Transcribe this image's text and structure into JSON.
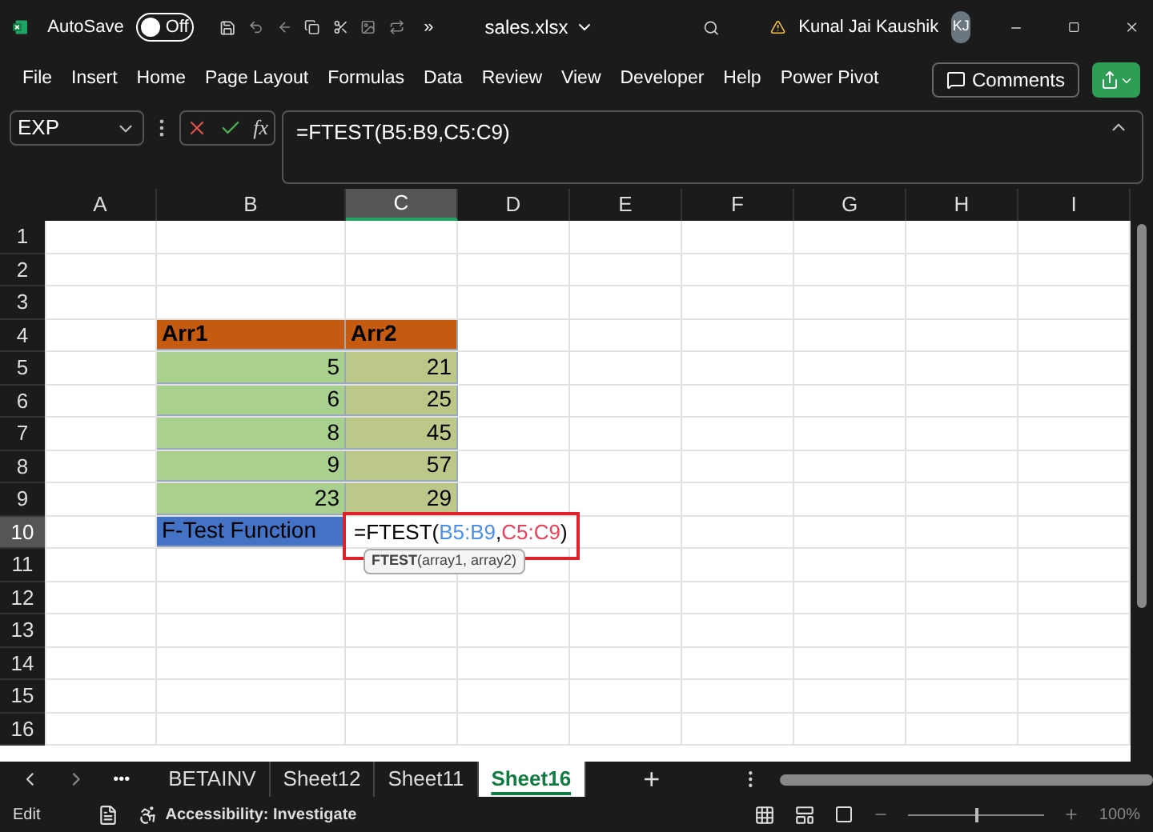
{
  "title_bar": {
    "autosave_label": "AutoSave",
    "autosave": {
      "on": false,
      "label": "Off"
    },
    "more": "»",
    "file_name": "sales.xlsx",
    "user": "Kunal Jai Kaushik",
    "initials": "KJ"
  },
  "menu": [
    "File",
    "Insert",
    "Home",
    "Page Layout",
    "Formulas",
    "Data",
    "Review",
    "View",
    "Developer",
    "Help",
    "Power Pivot"
  ],
  "comments_button": "Comments",
  "formula_bar": {
    "name_box": "EXP",
    "fx": "fx",
    "formula": "=FTEST(B5:B9,C5:C9)"
  },
  "columns": [
    {
      "label": "A",
      "selected": false
    },
    {
      "label": "B",
      "selected": false
    },
    {
      "label": "C",
      "selected": true
    },
    {
      "label": "D",
      "selected": false
    },
    {
      "label": "E",
      "selected": false
    },
    {
      "label": "F",
      "selected": false
    },
    {
      "label": "G",
      "selected": false
    },
    {
      "label": "H",
      "selected": false
    },
    {
      "label": "I",
      "selected": false
    }
  ],
  "rows": [
    {
      "label": "1",
      "selected": false
    },
    {
      "label": "2",
      "selected": false
    },
    {
      "label": "3",
      "selected": false
    },
    {
      "label": "4",
      "selected": false,
      "column_b": {
        "kind": "header",
        "text": "Arr1"
      },
      "column_c": {
        "kind": "header",
        "text": "Arr2"
      }
    },
    {
      "label": "5",
      "selected": false,
      "column_b": {
        "kind": "green",
        "text": "5"
      },
      "column_c": {
        "kind": "olive",
        "text": "21"
      }
    },
    {
      "label": "6",
      "selected": false,
      "column_b": {
        "kind": "green",
        "text": "6"
      },
      "column_c": {
        "kind": "olive",
        "text": "25"
      }
    },
    {
      "label": "7",
      "selected": false,
      "column_b": {
        "kind": "green",
        "text": "8"
      },
      "column_c": {
        "kind": "olive",
        "text": "45"
      }
    },
    {
      "label": "8",
      "selected": false,
      "column_b": {
        "kind": "green",
        "text": "9"
      },
      "column_c": {
        "kind": "olive",
        "text": "57"
      }
    },
    {
      "label": "9",
      "selected": false,
      "column_b": {
        "kind": "green",
        "text": "23"
      },
      "column_c": {
        "kind": "olive",
        "text": "29"
      }
    },
    {
      "label": "10",
      "selected": true,
      "column_b": {
        "kind": "blue",
        "text": "F-Test Function"
      },
      "column_c": {
        "kind": "editing",
        "opening": "=FTEST(",
        "arguments": [
          {
            "text": "B5:B9",
            "color": "#4a8fe8"
          },
          {
            "text": "C5:C9",
            "color": "#e8425a"
          }
        ],
        "separator": ",",
        "closing": ")"
      }
    },
    {
      "label": "11",
      "selected": false
    },
    {
      "label": "12",
      "selected": false
    },
    {
      "label": "13",
      "selected": false
    },
    {
      "label": "14",
      "selected": false
    },
    {
      "label": "15",
      "selected": false
    },
    {
      "label": "16",
      "selected": false
    }
  ],
  "tooltip": "**FTEST**(array1, array2)",
  "sheet_tabs": [
    {
      "label": "BETAINV",
      "selected": false
    },
    {
      "label": "Sheet12",
      "selected": false
    },
    {
      "label": "Sheet11",
      "selected": false
    },
    {
      "label": "Sheet16",
      "selected": true
    }
  ],
  "tab_more": "•••",
  "add_sheet": "+",
  "status_bar": {
    "mode": "Edit",
    "accessibility": "Accessibility: Investigate",
    "zoom_slider": {
      "level": 0.5
    },
    "zoom": "100%"
  }
}
